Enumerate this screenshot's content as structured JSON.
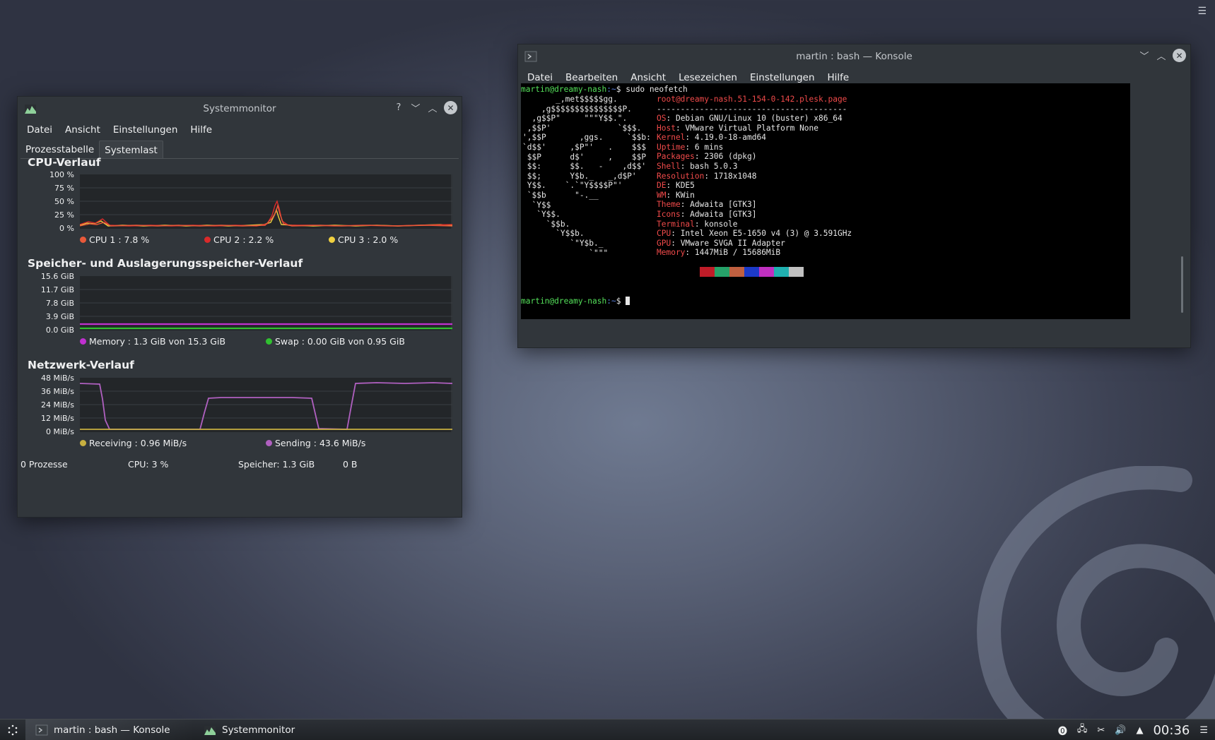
{
  "sysmon": {
    "title": "Systemmonitor",
    "menu": [
      "Datei",
      "Ansicht",
      "Einstellungen",
      "Hilfe"
    ],
    "tabs": [
      "Prozesstabelle",
      "Systemlast"
    ],
    "cpu": {
      "title": "CPU-Verlauf",
      "yticks": [
        "100 %",
        "75 %",
        "50 %",
        "25 %",
        "0 %"
      ],
      "legend": [
        "CPU 1 : 7.8 %",
        "CPU 2 : 2.2 %",
        "CPU 3 : 2.0 %"
      ],
      "colors": [
        "#e8593a",
        "#d92a2a",
        "#f0d040"
      ]
    },
    "mem": {
      "title": "Speicher- und Auslagerungsspeicher-Verlauf",
      "yticks": [
        "15.6 GiB",
        "11.7 GiB",
        "7.8 GiB",
        "3.9 GiB",
        "0.0 GiB"
      ],
      "legend": [
        "Memory : 1.3 GiB von 15.3 GiB",
        "Swap : 0.00 GiB von 0.95 GiB"
      ],
      "colors": [
        "#c030d0",
        "#30c030"
      ]
    },
    "net": {
      "title": "Netzwerk-Verlauf",
      "yticks": [
        "48 MiB/s",
        "36 MiB/s",
        "24 MiB/s",
        "12 MiB/s",
        "0 MiB/s"
      ],
      "legend": [
        "Receiving : 0.96 MiB/s",
        "Sending : 43.6 MiB/s"
      ],
      "colors": [
        "#c8b040",
        "#b060c0"
      ]
    },
    "status": {
      "processes": "0 Prozesse",
      "cpu": "CPU: 3 %",
      "memory": "Speicher: 1.3 GiB",
      "swap": "0 B"
    }
  },
  "konsole": {
    "title": "martin : bash — Konsole",
    "menu": [
      "Datei",
      "Bearbeiten",
      "Ansicht",
      "Lesezeichen",
      "Einstellungen",
      "Hilfe"
    ],
    "prompt_user": "martin@dreamy-nash",
    "prompt_path": ":~",
    "prompt_sym": "$ ",
    "command": "sudo neofetch",
    "logo": [
      "       _,met$$$$$gg.",
      "    ,g$$$$$$$$$$$$$$$P.",
      "  ,g$$P\"     \"\"\"Y$$.\".",
      " ,$$P'              `$$$.",
      "',$$P       ,ggs.     `$$b:",
      "`d$$'     ,$P\"'   .    $$$",
      " $$P      d$'     ,    $$P",
      " $$:      $$.   -    ,d$$'",
      " $$;      Y$b._   _,d$P'",
      " Y$$.    `.`\"Y$$$$P\"'",
      " `$$b      \"-.__",
      "  `Y$$",
      "   `Y$$.",
      "     `$$b.",
      "       `Y$$b.",
      "          `\"Y$b._",
      "              `\"\"\""
    ],
    "host_line": "root@dreamy-nash.51-154-0-142.plesk.page",
    "separator": "----------------------------------------",
    "info": [
      {
        "key": "OS",
        "value": "Debian GNU/Linux 10 (buster) x86_64"
      },
      {
        "key": "Host",
        "value": "VMware Virtual Platform None"
      },
      {
        "key": "Kernel",
        "value": "4.19.0-18-amd64"
      },
      {
        "key": "Uptime",
        "value": "6 mins"
      },
      {
        "key": "Packages",
        "value": "2306 (dpkg)"
      },
      {
        "key": "Shell",
        "value": "bash 5.0.3"
      },
      {
        "key": "Resolution",
        "value": "1718x1048"
      },
      {
        "key": "DE",
        "value": "KDE5"
      },
      {
        "key": "WM",
        "value": "KWin"
      },
      {
        "key": "Theme",
        "value": "Adwaita [GTK3]"
      },
      {
        "key": "Icons",
        "value": "Adwaita [GTK3]"
      },
      {
        "key": "Terminal",
        "value": "konsole"
      },
      {
        "key": "CPU",
        "value": "Intel Xeon E5-1650 v4 (3) @ 3.591GHz"
      },
      {
        "key": "GPU",
        "value": "VMware SVGA II Adapter"
      },
      {
        "key": "Memory",
        "value": "1447MiB / 15686MiB"
      }
    ],
    "palette": [
      "#000000",
      "#c01c28",
      "#26a269",
      "#c06040",
      "#1c3ac8",
      "#c030c0",
      "#20b0b0",
      "#c0c0c0"
    ]
  },
  "taskbar": {
    "tasks": [
      "martin : bash — Konsole",
      "Systemmonitor"
    ],
    "clock": "00:36"
  }
}
